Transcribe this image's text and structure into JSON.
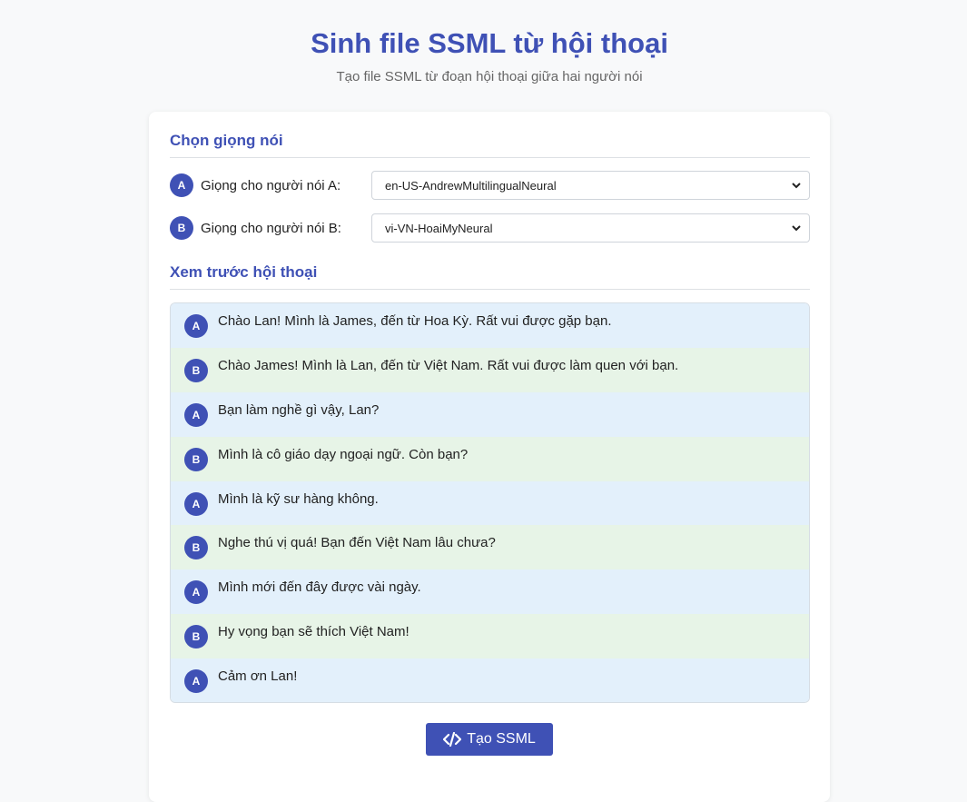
{
  "header": {
    "title": "Sinh file SSML từ hội thoại",
    "subtitle": "Tạo file SSML từ đoạn hội thoại giữa hai người nói"
  },
  "voices": {
    "heading": "Chọn giọng nói",
    "speaker_a": {
      "badge": "A",
      "label": "Giọng cho người nói A:",
      "selected": "en-US-AndrewMultilingualNeural"
    },
    "speaker_b": {
      "badge": "B",
      "label": "Giọng cho người nói B:",
      "selected": "vi-VN-HoaiMyNeural"
    }
  },
  "preview": {
    "heading": "Xem trước hội thoại",
    "lines": [
      {
        "speaker": "A",
        "text": "Chào Lan! Mình là James, đến từ Hoa Kỳ. Rất vui được gặp bạn."
      },
      {
        "speaker": "B",
        "text": "Chào James! Mình là Lan, đến từ Việt Nam. Rất vui được làm quen với bạn."
      },
      {
        "speaker": "A",
        "text": "Bạn làm nghề gì vậy, Lan?"
      },
      {
        "speaker": "B",
        "text": "Mình là cô giáo dạy ngoại ngữ. Còn bạn?"
      },
      {
        "speaker": "A",
        "text": "Mình là kỹ sư hàng không."
      },
      {
        "speaker": "B",
        "text": "Nghe thú vị quá! Bạn đến Việt Nam lâu chưa?"
      },
      {
        "speaker": "A",
        "text": "Mình mới đến đây được vài ngày."
      },
      {
        "speaker": "B",
        "text": "Hy vọng bạn sẽ thích Việt Nam!"
      },
      {
        "speaker": "A",
        "text": "Cảm ơn Lan!"
      }
    ]
  },
  "actions": {
    "generate_label": "Tạo SSML",
    "generate_icon": "code-icon"
  },
  "colors": {
    "accent": "#3f51b5",
    "speaker_a_bg": "#e3f0fb",
    "speaker_b_bg": "#e7f4e7"
  }
}
